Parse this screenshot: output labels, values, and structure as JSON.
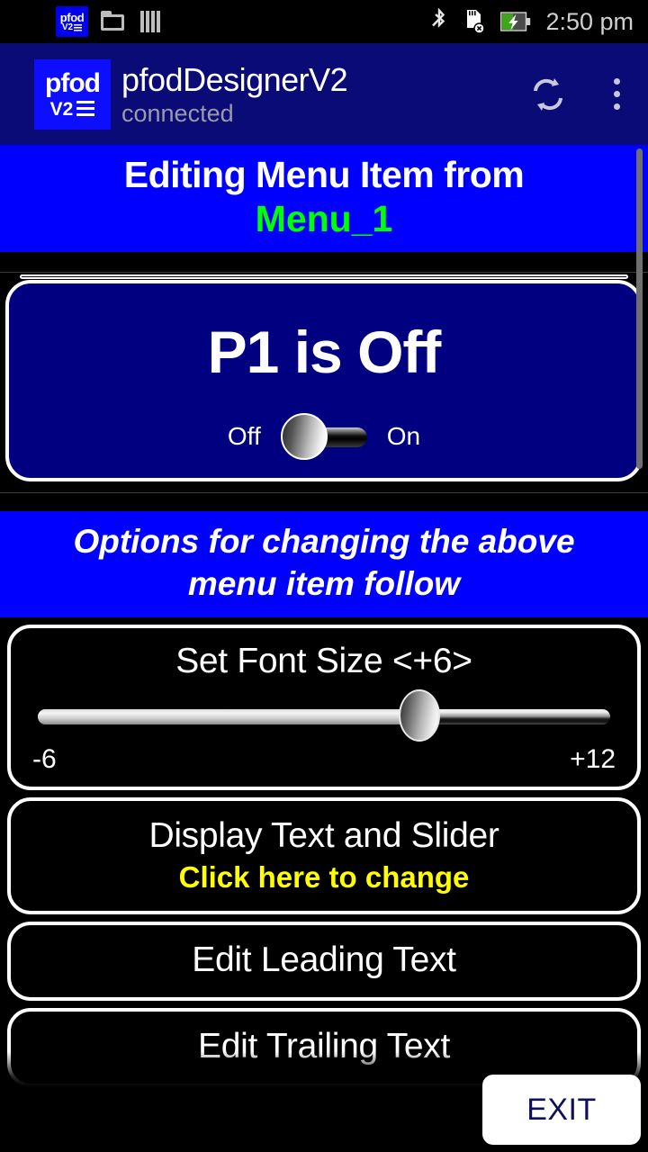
{
  "status_bar": {
    "notification_icons": [
      "pfod-v2-app-icon",
      "folder-icon",
      "bars-icon"
    ],
    "system_icons": [
      "bluetooth-icon",
      "sd-card-removed-icon",
      "battery-charging-icon"
    ],
    "pfod_icon_line1": "pfod",
    "pfod_icon_line2": "V2",
    "time": "2:50 pm"
  },
  "app_bar": {
    "logo_text": "pfod",
    "logo_version": "V2",
    "title": "pfodDesignerV2",
    "subtitle": "connected",
    "refresh_icon": "refresh-icon",
    "overflow_icon": "overflow-menu-icon"
  },
  "banner": {
    "line1": "Editing Menu Item from",
    "line2": "Menu_1",
    "line2_color": "#00ff00",
    "background": "#0000ff"
  },
  "preview": {
    "label": "P1 is Off",
    "toggle_off_label": "Off",
    "toggle_on_label": "On",
    "toggle_state": "off",
    "background": "#000080"
  },
  "options_banner": {
    "line1": "Options for changing the above",
    "line2": "menu item follow"
  },
  "font_size_card": {
    "title": "Set Font Size <+6>",
    "min_label": "-6",
    "max_label": "+12",
    "min_value": -6,
    "max_value": 12,
    "value": 6,
    "thumb_percent": 66.7
  },
  "buttons": [
    {
      "title": "Display Text and Slider",
      "subtitle": "Click here to change",
      "subtitle_color": "#ffff00"
    },
    {
      "title": "Edit Leading Text",
      "subtitle": ""
    },
    {
      "title": "Edit Trailing Text",
      "subtitle": ""
    }
  ],
  "exit_button": {
    "label": "EXIT",
    "background": "#ffffff",
    "text_color": "#101058"
  }
}
